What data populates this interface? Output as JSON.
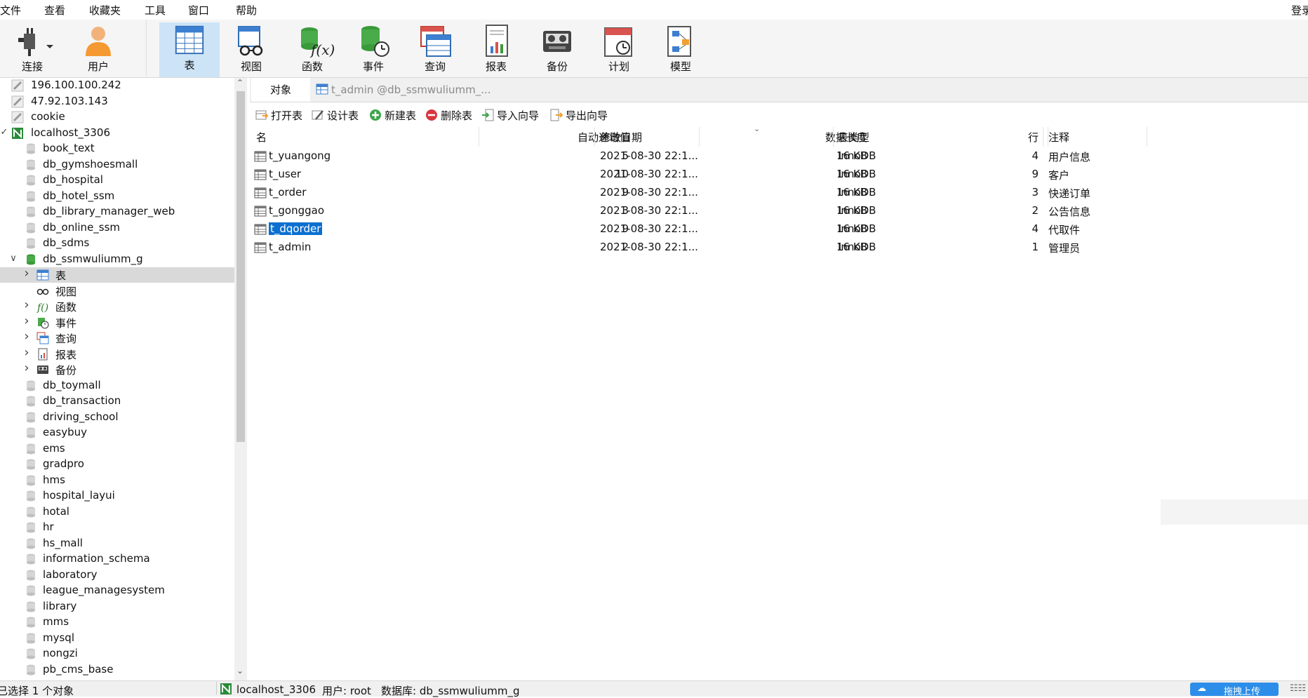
{
  "menu": [
    "文件",
    "查看",
    "收藏夹",
    "工具",
    "窗口",
    "帮助"
  ],
  "menu_right": "登录",
  "toolbar": [
    {
      "label": "连接",
      "icon": "plug-icon"
    },
    {
      "label": "用户",
      "icon": "user-icon"
    },
    {
      "label": "表",
      "icon": "table-icon",
      "active": true
    },
    {
      "label": "视图",
      "icon": "view-glasses-icon"
    },
    {
      "label": "函数",
      "icon": "function-icon"
    },
    {
      "label": "事件",
      "icon": "event-icon"
    },
    {
      "label": "查询",
      "icon": "query-icon"
    },
    {
      "label": "报表",
      "icon": "report-icon"
    },
    {
      "label": "备份",
      "icon": "backup-icon"
    },
    {
      "label": "计划",
      "icon": "calendar-icon"
    },
    {
      "label": "模型",
      "icon": "model-icon"
    }
  ],
  "tree": [
    {
      "label": "196.100.100.242",
      "type": "connection-off"
    },
    {
      "label": "47.92.103.143",
      "type": "connection-off"
    },
    {
      "label": "cookie",
      "type": "connection-off"
    },
    {
      "label": "localhost_3306",
      "type": "connection-on",
      "expanded": true
    },
    {
      "label": "book_text",
      "type": "db"
    },
    {
      "label": "db_gymshoesmall",
      "type": "db"
    },
    {
      "label": "db_hospital",
      "type": "db"
    },
    {
      "label": "db_hotel_ssm",
      "type": "db"
    },
    {
      "label": "db_library_manager_web",
      "type": "db"
    },
    {
      "label": "db_online_ssm",
      "type": "db"
    },
    {
      "label": "db_sdms",
      "type": "db"
    },
    {
      "label": "db_ssmwuliumm_g",
      "type": "db-open",
      "expanded": true
    },
    {
      "label": "表",
      "type": "folder-table",
      "selected": true
    },
    {
      "label": "视图",
      "type": "folder-view"
    },
    {
      "label": "函数",
      "type": "folder-func"
    },
    {
      "label": "事件",
      "type": "folder-event"
    },
    {
      "label": "查询",
      "type": "folder-query"
    },
    {
      "label": "报表",
      "type": "folder-report"
    },
    {
      "label": "备份",
      "type": "folder-backup"
    },
    {
      "label": "db_toymall",
      "type": "db"
    },
    {
      "label": "db_transaction",
      "type": "db"
    },
    {
      "label": "driving_school",
      "type": "db"
    },
    {
      "label": "easybuy",
      "type": "db"
    },
    {
      "label": "ems",
      "type": "db"
    },
    {
      "label": "gradpro",
      "type": "db"
    },
    {
      "label": "hms",
      "type": "db"
    },
    {
      "label": "hospital_layui",
      "type": "db"
    },
    {
      "label": "hotal",
      "type": "db"
    },
    {
      "label": "hr",
      "type": "db"
    },
    {
      "label": "hs_mall",
      "type": "db"
    },
    {
      "label": "information_schema",
      "type": "db"
    },
    {
      "label": "laboratory",
      "type": "db"
    },
    {
      "label": "league_managesystem",
      "type": "db"
    },
    {
      "label": "library",
      "type": "db"
    },
    {
      "label": "mms",
      "type": "db"
    },
    {
      "label": "mysql",
      "type": "db"
    },
    {
      "label": "nongzi",
      "type": "db"
    },
    {
      "label": "pb_cms_base",
      "type": "db"
    }
  ],
  "tabs": {
    "object": "对象",
    "current": "t_admin @db_ssmwuliumm_..."
  },
  "actions": [
    "打开表",
    "设计表",
    "新建表",
    "删除表",
    "导入向导",
    "导出向导"
  ],
  "columns": [
    "名",
    "自动递增值",
    "修改日期",
    "数据长度",
    "表类型",
    "行",
    "注释"
  ],
  "rows": [
    {
      "name": "t_yuangong",
      "auto_inc": "5",
      "modified": "2021-08-30 22:1...",
      "size": "16 KB",
      "engine": "InnoDB",
      "rows": "4",
      "comment": "用户信息"
    },
    {
      "name": "t_user",
      "auto_inc": "10",
      "modified": "2021-08-30 22:1...",
      "size": "16 KB",
      "engine": "InnoDB",
      "rows": "9",
      "comment": "客户"
    },
    {
      "name": "t_order",
      "auto_inc": "9",
      "modified": "2021-08-30 22:1...",
      "size": "16 KB",
      "engine": "InnoDB",
      "rows": "3",
      "comment": "快递订单"
    },
    {
      "name": "t_gonggao",
      "auto_inc": "3",
      "modified": "2021-08-30 22:1...",
      "size": "16 KB",
      "engine": "InnoDB",
      "rows": "2",
      "comment": "公告信息"
    },
    {
      "name": "t_dqorder",
      "auto_inc": "9",
      "modified": "2021-08-30 22:1...",
      "size": "16 KB",
      "engine": "InnoDB",
      "rows": "4",
      "comment": "代取件",
      "selected": true
    },
    {
      "name": "t_admin",
      "auto_inc": "2",
      "modified": "2021-08-30 22:1...",
      "size": "16 KB",
      "engine": "InnoDB",
      "rows": "1",
      "comment": "管理员"
    }
  ],
  "status": {
    "selection": "已选择 1 个对象",
    "connection": "localhost_3306",
    "user": "用户: root",
    "database": "数据库: db_ssmwuliumm_g",
    "upload": "拖拽上传"
  }
}
